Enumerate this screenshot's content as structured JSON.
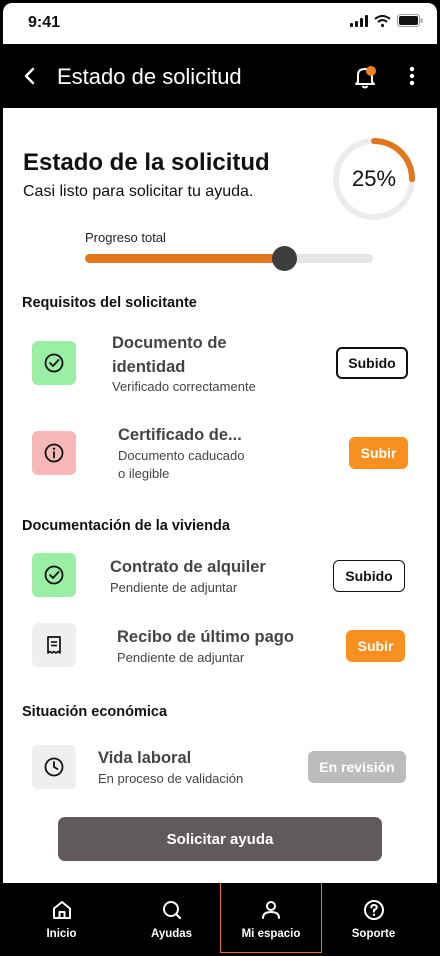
{
  "status_bar": {
    "time": "9:41"
  },
  "app_bar": {
    "title": "Estado de solicitud"
  },
  "hero": {
    "title": "Estado de la solicitud",
    "subtitle": "Casi listo para solicitar tu ayuda.",
    "percent_label": "25%",
    "ring_progress": 0.25
  },
  "progress": {
    "label": "Progreso total",
    "value": 0.69
  },
  "sections": [
    {
      "title": "Requisitos del solicitante",
      "items": [
        {
          "icon": "check-circle-icon",
          "title_line1": "Documento de",
          "title_line2": "identidad",
          "desc_line1": "Verificado correctamente",
          "button": "Subido"
        },
        {
          "icon": "info-circle-icon",
          "title_line1": "Certificado de...",
          "desc_line1": "Documento caducado",
          "desc_line2": "o ilegible",
          "button": "Subir"
        }
      ]
    },
    {
      "title": "Documentación de la vivienda",
      "items": [
        {
          "icon": "check-circle-icon",
          "title_line1": "Contrato de alquiler",
          "desc_line1": "Pendiente de adjuntar",
          "button": "Subido"
        },
        {
          "icon": "receipt-icon",
          "title_line1": "Recibo de último pago",
          "desc_line1": "Pendiente de adjuntar",
          "button": "Subir"
        }
      ]
    },
    {
      "title": "Situación económica",
      "items": [
        {
          "icon": "clock-icon",
          "title_line1": "Vida laboral",
          "desc_line1": "En proceso de validación",
          "button": "En revisión"
        }
      ]
    }
  ],
  "cta": {
    "label": "Solicitar ayuda"
  },
  "nav": [
    {
      "icon": "home-icon",
      "label": "Inicio"
    },
    {
      "icon": "search-icon",
      "label": "Ayudas"
    },
    {
      "icon": "user-icon",
      "label": "Mi espacio",
      "active": true
    },
    {
      "icon": "help-icon",
      "label": "Soporte"
    }
  ],
  "colors": {
    "accent": "#e0771c",
    "button_orange": "#f7901e",
    "success_bg": "#9aefa5",
    "error_bg": "#f5b7b7",
    "cta_bg": "#605a5a"
  }
}
